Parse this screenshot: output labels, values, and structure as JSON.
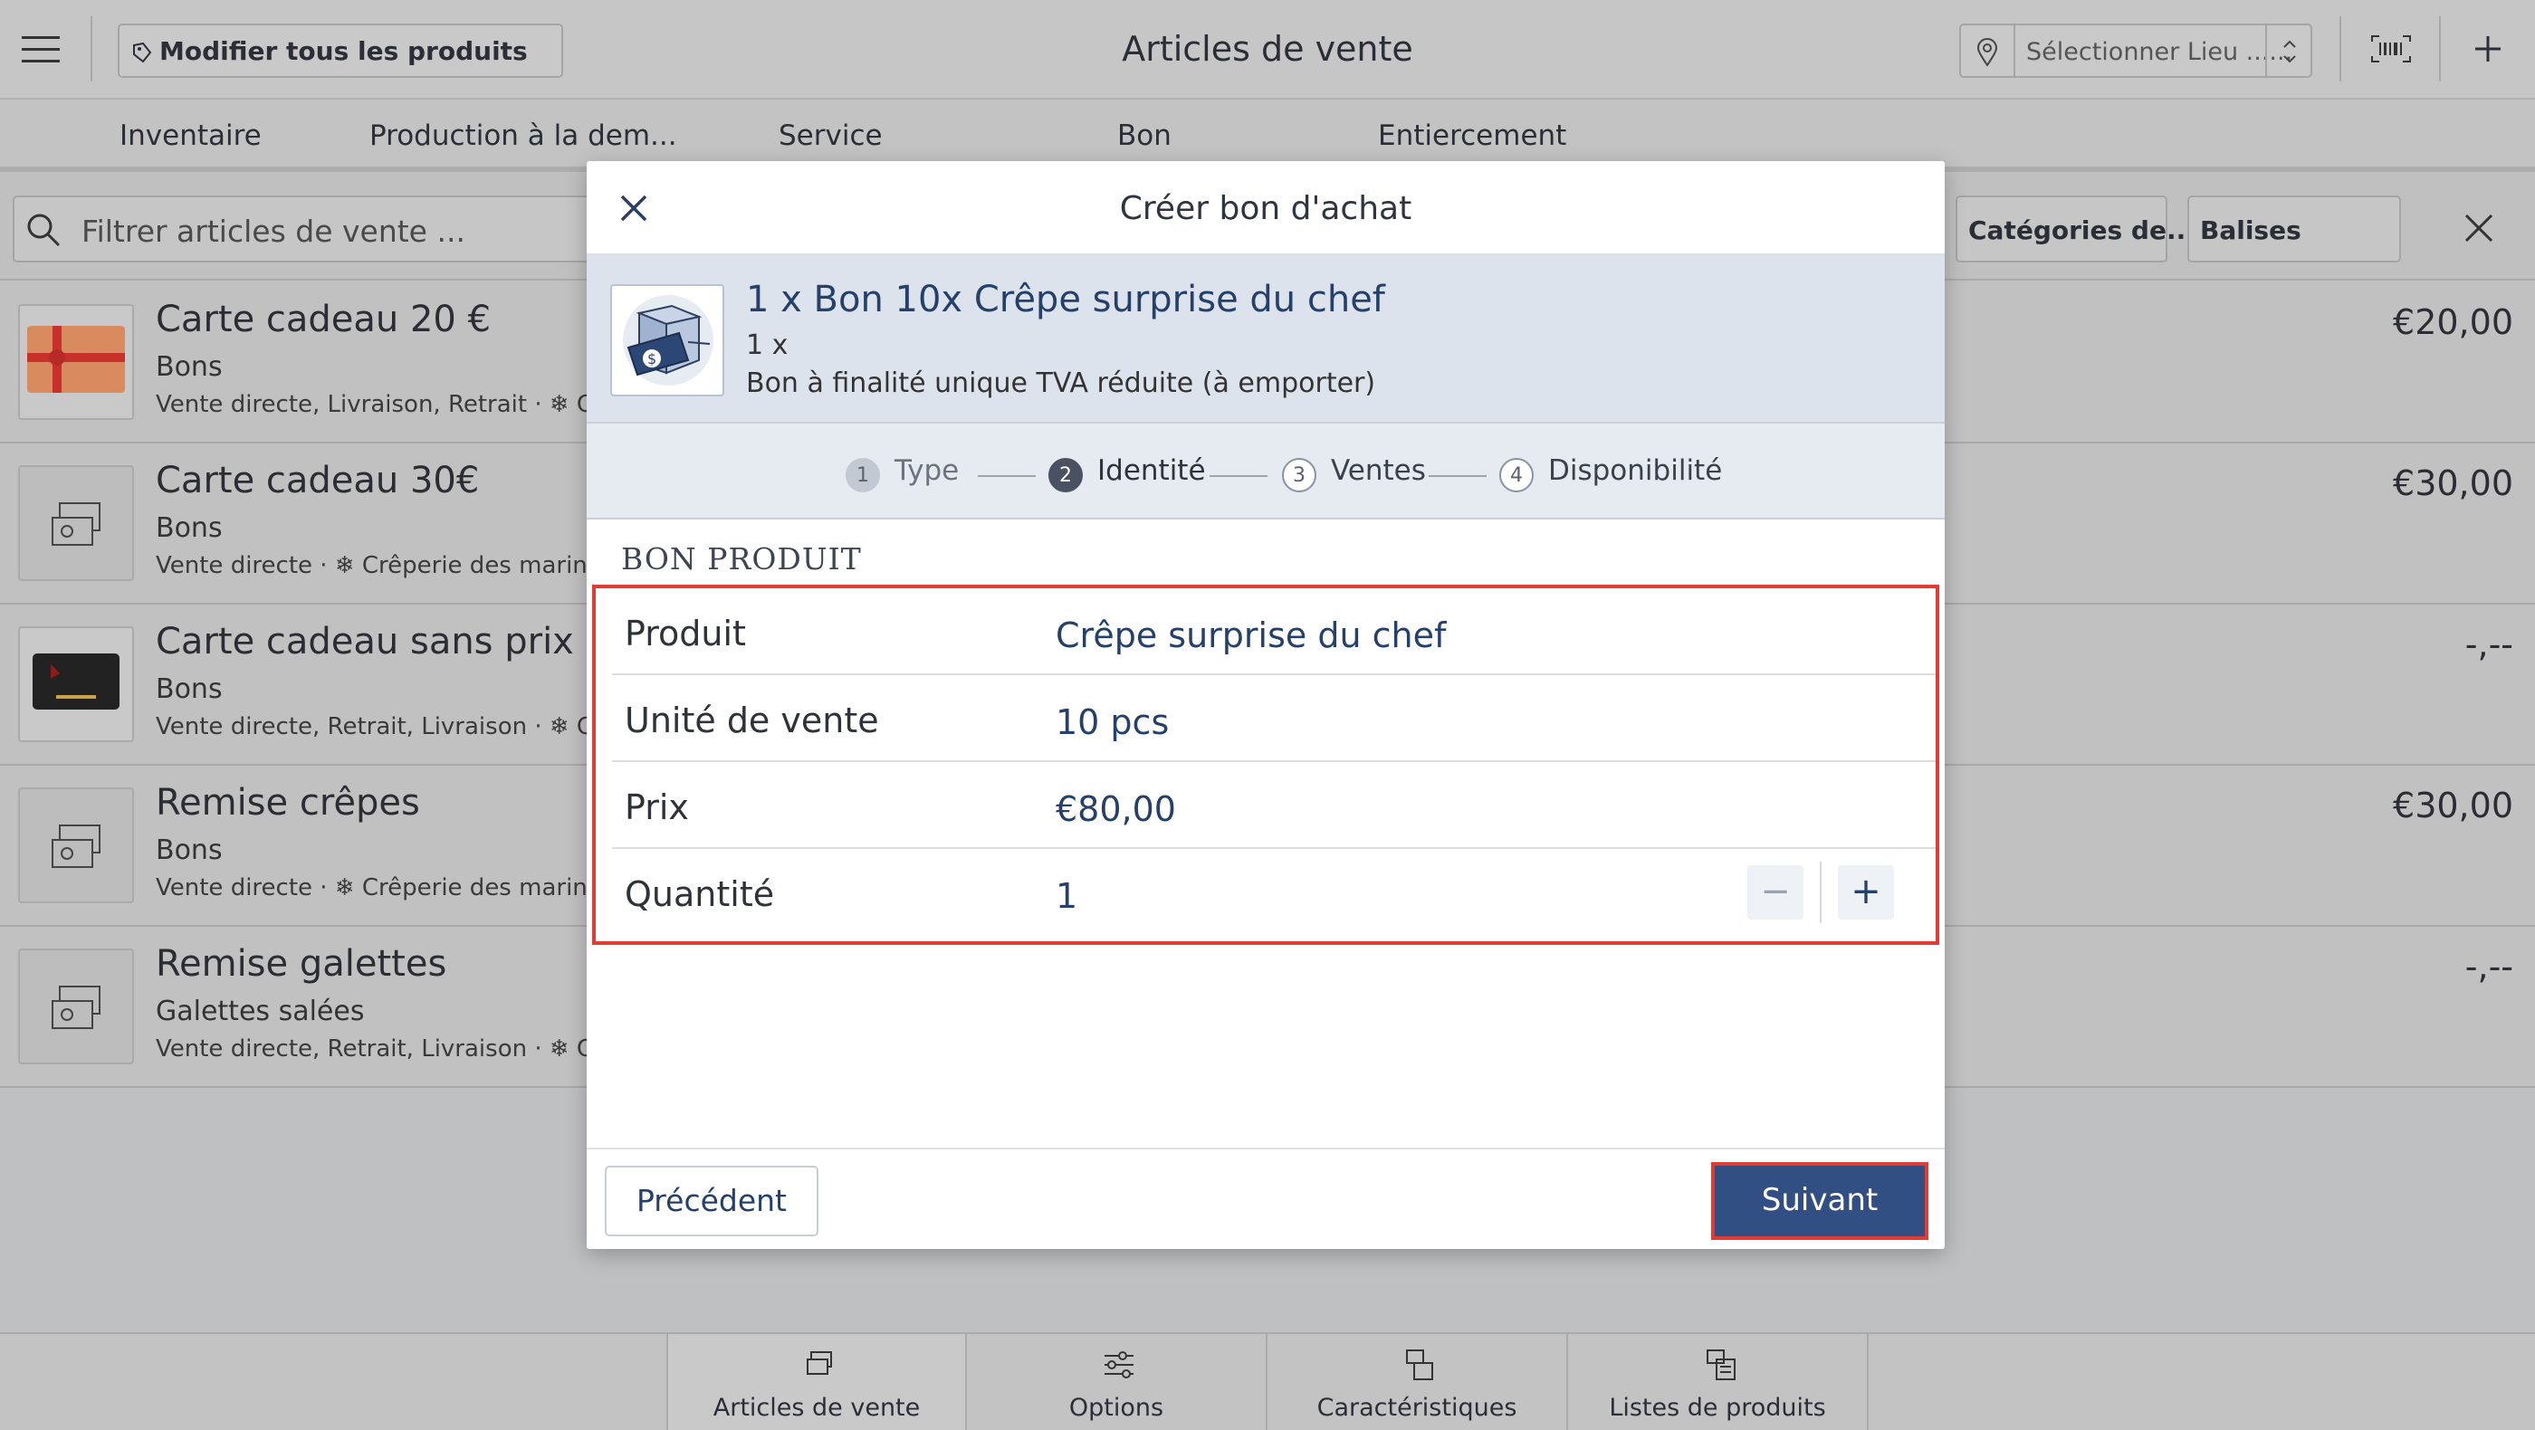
{
  "header": {
    "menu_icon": "hamburger-icon",
    "edit_all_label": "Modifier tous les produits",
    "title": "Articles de vente",
    "location_placeholder": "Sélectionner Lieu ......"
  },
  "tabs": [
    "Inventaire",
    "Production à la dem...",
    "Service",
    "Bon",
    "Entiercement"
  ],
  "filter": {
    "placeholder": "Filtrer articles de vente ...",
    "categories_label": "Catégories de...",
    "tags_label": "Balises"
  },
  "items": [
    {
      "title": "Carte cadeau 20 €",
      "subtitle": "Bons",
      "meta": "Vente directe, Livraison, Retrait · ❄ Cr",
      "price": "€20,00",
      "thumb": "gift-card"
    },
    {
      "title": "Carte cadeau 30€",
      "subtitle": "Bons",
      "meta": "Vente directe · ❄ Crêperie des marins",
      "price": "€30,00",
      "thumb": "voucher-icon"
    },
    {
      "title": "Carte cadeau sans prix",
      "subtitle": "Bons",
      "meta": "Vente directe, Retrait, Livraison · ❄ Cr",
      "price": "-,--",
      "thumb": "black-gift-card"
    },
    {
      "title": "Remise crêpes",
      "subtitle": "Bons",
      "meta": "Vente directe · ❄ Crêperie des marins",
      "price": "€30,00",
      "thumb": "voucher-icon"
    },
    {
      "title": "Remise galettes",
      "subtitle": "Galettes salées",
      "meta": "Vente directe, Retrait, Livraison · ❄ Cr",
      "price": "-,--",
      "thumb": "voucher-icon"
    }
  ],
  "bottom_nav": [
    "Articles de vente",
    "Options",
    "Caractéristiques",
    "Listes de produits"
  ],
  "modal": {
    "title": "Créer bon d'achat",
    "product_title": "1 x Bon 10x Crêpe surprise du chef",
    "product_qty": "1 x",
    "product_desc": "Bon à finalité unique TVA réduite (à emporter)",
    "steps": [
      {
        "num": "1",
        "label": "Type"
      },
      {
        "num": "2",
        "label": "Identité"
      },
      {
        "num": "3",
        "label": "Ventes"
      },
      {
        "num": "4",
        "label": "Disponibilité"
      }
    ],
    "section": "BON PRODUIT",
    "fields": {
      "product_label": "Produit",
      "product_value": "Crêpe surprise du chef",
      "unit_label": "Unité de vente",
      "unit_value": "10 pcs",
      "price_label": "Prix",
      "price_value": "€80,00",
      "qty_label": "Quantité",
      "qty_value": "1"
    },
    "minus": "−",
    "plus": "+",
    "prev_label": "Précédent",
    "next_label": "Suivant"
  },
  "colors": {
    "accent": "#324f83",
    "highlight": "#e23b33",
    "link": "#24406b"
  }
}
